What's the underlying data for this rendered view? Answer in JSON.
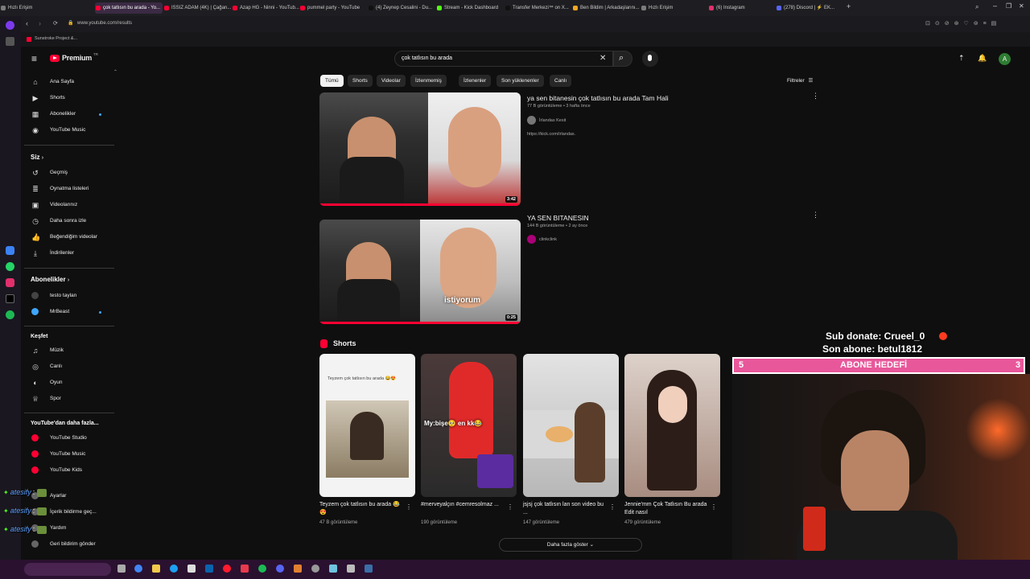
{
  "browser": {
    "tabs": [
      {
        "label": "Hızlı Erişim",
        "color": "#7c7c7c"
      },
      {
        "label": "çok tatlısın bu arada - Yo...",
        "color": "#ff0033",
        "active": true
      },
      {
        "label": "ISSIZ ADAM (4K) | Çağan...",
        "color": "#ff0033"
      },
      {
        "label": "Azap HG - Ninni - YouTub...",
        "color": "#ff0033"
      },
      {
        "label": "pummel party - YouTube",
        "color": "#ff0033"
      },
      {
        "label": "(4) Zeynep Cesalini - Du...",
        "color": "#111111"
      },
      {
        "label": "Stream - Kick Dashboard",
        "color": "#53fc18"
      },
      {
        "label": "Transfer Merkezi™ on X...",
        "color": "#111111"
      },
      {
        "label": "Ben Bildim | Arkadaşlarını...",
        "color": "#f5a623"
      },
      {
        "label": "Hızlı Erişim",
        "color": "#7c7c7c"
      },
      {
        "label": "(6) Instagram",
        "color": "#e1306c"
      },
      {
        "label": "(278) Discord | ⚡ EK...",
        "color": "#5865f2"
      }
    ],
    "url": "www.youtube.com/results",
    "bookmark": "Sunstroke Project &..."
  },
  "header": {
    "logo_text": "Premium",
    "logo_sup": "TR",
    "search_value": "çok tatlısın bu arada",
    "avatar_letter": "A"
  },
  "sidebar": {
    "main": [
      {
        "label": "Ana Sayfa",
        "icon": "home-icon"
      },
      {
        "label": "Shorts",
        "icon": "shorts-icon"
      },
      {
        "label": "Abonelikler",
        "icon": "subscriptions-icon"
      },
      {
        "label": "YouTube Music",
        "icon": "music-icon"
      }
    ],
    "you_title": "Siz",
    "you": [
      {
        "label": "Geçmiş",
        "icon": "history-icon"
      },
      {
        "label": "Oynatma listeleri",
        "icon": "playlist-icon"
      },
      {
        "label": "Videolarınız",
        "icon": "video-icon"
      },
      {
        "label": "Daha sonra izle",
        "icon": "clock-icon"
      },
      {
        "label": "Beğendiğim videolar",
        "icon": "like-icon"
      },
      {
        "label": "İndirilenler",
        "icon": "download-icon"
      }
    ],
    "subs_title": "Abonelikler",
    "subs": [
      {
        "label": "testo taylan"
      },
      {
        "label": "MrBeast"
      }
    ],
    "explore_title": "Keşfet",
    "explore": [
      {
        "label": "Müzik",
        "icon": "music-note-icon"
      },
      {
        "label": "Canlı",
        "icon": "live-icon"
      },
      {
        "label": "Oyun",
        "icon": "gaming-icon"
      },
      {
        "label": "Spor",
        "icon": "trophy-icon"
      }
    ],
    "more_title": "YouTube'dan daha fazla...",
    "more": [
      {
        "label": "YouTube Studio"
      },
      {
        "label": "YouTube Music"
      },
      {
        "label": "YouTube Kids"
      }
    ],
    "bottom": [
      {
        "label": "Ayarlar"
      },
      {
        "label": "İçerik bildirme geç..."
      },
      {
        "label": "Yardım"
      },
      {
        "label": "Geri bildirim gönder"
      }
    ]
  },
  "chips": [
    "Tümü",
    "Shorts",
    "Videolar",
    "İzlenmemiş",
    "İzlenenler",
    "Son yüklenenler",
    "Canlı"
  ],
  "filters_label": "Filtreler",
  "videos": [
    {
      "title": "ya sen bitanesin çok tatlısın bu arada Tam Hali",
      "meta": "77 B görüntüleme • 3 hafta önce",
      "channel": "İrlandas Kesit",
      "desc": "https://kick.com/irlandas.",
      "duration": "3:42"
    },
    {
      "title": "YA SEN BITANESIN",
      "meta": "144 B görüntüleme • 2 ay önce",
      "channel": "clinkclink",
      "desc": "",
      "duration": "0:25",
      "caption": "istiyorum"
    }
  ],
  "shorts_title": "Shorts",
  "shorts": [
    {
      "title": "Teyzem çok tatlısın bu arada 😂😍",
      "views": "47 B görüntüleme",
      "overlay": "Teyzem çok tatlısın bu arada 😂😍"
    },
    {
      "title": "#merveyalçın #cemresolmaz ...",
      "views": "190 görüntüleme",
      "overlay": "My:bişe🥺 en kk😂"
    },
    {
      "title": "jsjsj çok tatlısın lan son video bu ...",
      "views": "147 görüntüleme",
      "overlay": ""
    },
    {
      "title": "Jennie'mm Çok Tatlısın Bu arada Edit nasıl",
      "views": "479 görüntüleme",
      "overlay": ""
    }
  ],
  "show_more": "Daha fazla göster",
  "stream_overlay": {
    "sub_donate": "Sub donate: Crueel_0",
    "last_sub": "Son abone: betul1812",
    "goal_label": "ABONE HEDEFİ",
    "goal_left": "5",
    "goal_right": "3"
  },
  "chat": [
    {
      "user": "atesify",
      "msg": ":"
    },
    {
      "user": "atesify",
      "msg": ":"
    },
    {
      "user": "atesify",
      "msg": ":"
    },
    {
      "user": "atesify",
      "msg": ":"
    }
  ],
  "colors": {
    "yt_red": "#ff0033",
    "goal_bar": "#e8579a",
    "chat_green": "#53fc18",
    "chat_user": "#5aa0ff"
  }
}
